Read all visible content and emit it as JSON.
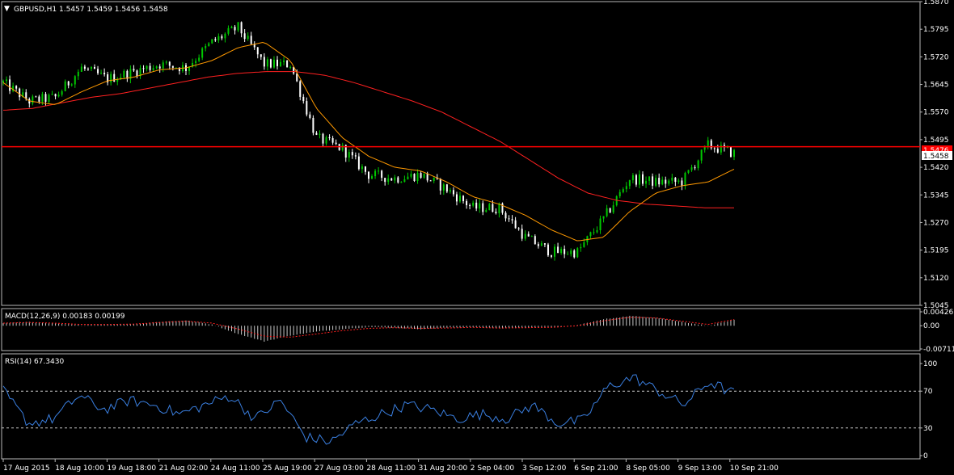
{
  "colors": {
    "background": "#000000",
    "frame": "#b8b8b8",
    "text": "#ffffff",
    "bull_candle": "#00c800",
    "bear_candle": "#ffffff",
    "ma_fast": "#ff9900",
    "ma_slow": "#ff2020",
    "hline": "#ff0000",
    "macd_hist": "#c8c8c8",
    "macd_signal": "#ff2020",
    "rsi_line": "#3a7fe0",
    "level_line": "#c8c8c8"
  },
  "main_panel": {
    "header_arrow": "▼",
    "header": "GBPUSD,H1  1.5457 1.5459 1.5456 1.5458",
    "price_ticks": [
      "1.5870",
      "1.5795",
      "1.5720",
      "1.5645",
      "1.5570",
      "1.5495",
      "1.5420",
      "1.5345",
      "1.5270",
      "1.5195",
      "1.5120",
      "1.5045"
    ],
    "hline_label": "1.5476",
    "bid_label": "1.5458"
  },
  "macd_panel": {
    "header": "MACD(12,26,9) 0.00183 0.00199",
    "ticks": [
      "0.00426",
      "0.00",
      "-0.00711"
    ]
  },
  "rsi_panel": {
    "header": "RSI(14) 67.3430",
    "ticks": [
      "100",
      "70",
      "30",
      "0"
    ]
  },
  "time_axis": [
    "17 Aug 2015",
    "18 Aug 10:00",
    "19 Aug 18:00",
    "21 Aug 02:00",
    "24 Aug 11:00",
    "25 Aug 19:00",
    "27 Aug 03:00",
    "28 Aug 11:00",
    "31 Aug 20:00",
    "2 Sep 04:00",
    "3 Sep 12:00",
    "6 Sep 21:00",
    "8 Sep 05:00",
    "9 Sep 13:00",
    "10 Sep 21:00"
  ],
  "chart_data": [
    {
      "type": "candlestick",
      "symbol": "GBPUSD",
      "timeframe": "H1",
      "ylim": [
        1.5045,
        1.587
      ],
      "hline": 1.5476,
      "last_price": 1.5458,
      "close_anchors": [
        1.565,
        1.56,
        1.561,
        1.569,
        1.566,
        1.568,
        1.57,
        1.569,
        1.576,
        1.58,
        1.57,
        1.57,
        1.55,
        1.547,
        1.54,
        1.539,
        1.54,
        1.536,
        1.531,
        1.531,
        1.523,
        1.519,
        1.519,
        1.528,
        1.539,
        1.538,
        1.538,
        1.548,
        1.5458
      ],
      "ma_fast": [
        1.565,
        1.56,
        1.559,
        1.5625,
        1.5655,
        1.5665,
        1.5685,
        1.569,
        1.571,
        1.5745,
        1.576,
        1.571,
        1.558,
        1.55,
        1.545,
        1.542,
        1.541,
        1.538,
        1.534,
        1.532,
        1.529,
        1.525,
        1.522,
        1.523,
        1.53,
        1.535,
        1.537,
        1.538,
        1.5415
      ],
      "ma_slow": [
        1.5575,
        1.558,
        1.5595,
        1.561,
        1.562,
        1.5635,
        1.565,
        1.5665,
        1.5675,
        1.568,
        1.568,
        1.567,
        1.565,
        1.5625,
        1.56,
        1.557,
        1.553,
        1.549,
        1.544,
        1.539,
        1.535,
        1.533,
        1.532,
        1.5315,
        1.531,
        1.531
      ]
    },
    {
      "type": "histogram",
      "name": "MACD(12,26,9)",
      "ylim": [
        -0.00711,
        0.00426
      ],
      "hist_anchors": [
        0.0008,
        0.0012,
        0.0006,
        0.0002,
        0.0004,
        0.0005,
        0.0012,
        0.0016,
        0.0004,
        -0.0025,
        -0.0048,
        -0.003,
        -0.0018,
        -0.001,
        -0.0004,
        -0.0006,
        -0.001,
        -0.0006,
        -0.0004,
        -0.0008,
        -0.0006,
        -0.0004,
        0.0002,
        0.002,
        0.003,
        0.0025,
        0.0012,
        0.0,
        0.0018
      ],
      "signal_anchors": [
        0.0008,
        0.001,
        0.0008,
        0.0004,
        0.0004,
        0.0005,
        0.001,
        0.0014,
        0.0008,
        -0.001,
        -0.0032,
        -0.0035,
        -0.0025,
        -0.0015,
        -0.0008,
        -0.0006,
        -0.0008,
        -0.0007,
        -0.0005,
        -0.0007,
        -0.0006,
        -0.0005,
        0.0,
        0.0015,
        0.0026,
        0.0024,
        0.0014,
        0.0004,
        0.0019
      ]
    },
    {
      "type": "line",
      "name": "RSI(14)",
      "ylim": [
        0,
        100
      ],
      "levels": [
        70,
        30
      ],
      "anchors": [
        70,
        35,
        40,
        65,
        50,
        60,
        55,
        45,
        55,
        65,
        40,
        60,
        20,
        15,
        35,
        45,
        55,
        50,
        40,
        45,
        40,
        55,
        35,
        38,
        75,
        85,
        70,
        55,
        80,
        67.343
      ]
    }
  ]
}
